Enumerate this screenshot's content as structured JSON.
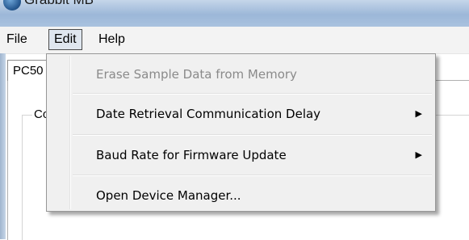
{
  "window": {
    "title": "Grabbit MB"
  },
  "menubar": {
    "file": "File",
    "edit": "Edit",
    "help": "Help"
  },
  "tab": {
    "label": "PC50"
  },
  "group": {
    "label": "Co"
  },
  "edit_menu": {
    "items": [
      {
        "label": "Erase Sample Data from Memory",
        "enabled": false,
        "submenu": false
      },
      {
        "label": "Date Retrieval Communication Delay",
        "enabled": true,
        "submenu": true,
        "arrow": "▶"
      },
      {
        "label": "Baud Rate for Firmware Update",
        "enabled": true,
        "submenu": true,
        "arrow": "▶"
      },
      {
        "label": "Open Device Manager...",
        "enabled": true,
        "submenu": false
      }
    ]
  }
}
